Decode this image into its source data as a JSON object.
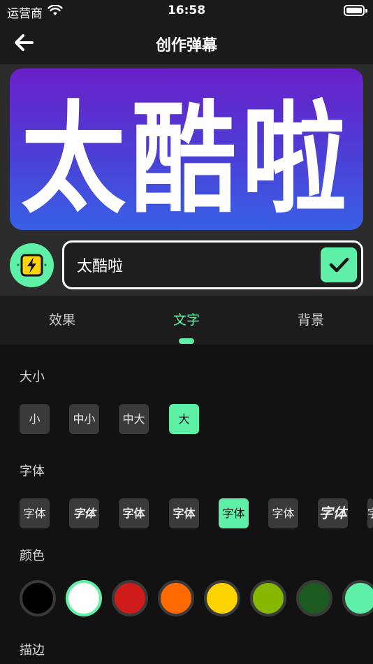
{
  "status": {
    "carrier": "运营商",
    "time": "16:58"
  },
  "nav": {
    "title": "创作弹幕"
  },
  "preview": {
    "text": "太酷啦"
  },
  "editor": {
    "value": "太酷啦",
    "placeholder": ""
  },
  "tabs": [
    {
      "label": "效果",
      "active": false
    },
    {
      "label": "文字",
      "active": true
    },
    {
      "label": "背景",
      "active": false
    }
  ],
  "size": {
    "label": "大小",
    "options": [
      {
        "label": "小",
        "active": false
      },
      {
        "label": "中小",
        "active": false
      },
      {
        "label": "中大",
        "active": false
      },
      {
        "label": "大",
        "active": true
      }
    ]
  },
  "font": {
    "label": "字体",
    "options": [
      {
        "label": "字体",
        "style": "regular",
        "active": false
      },
      {
        "label": "字体",
        "style": "italic",
        "active": false
      },
      {
        "label": "字体",
        "style": "bold",
        "active": false
      },
      {
        "label": "字体",
        "style": "bold",
        "active": false
      },
      {
        "label": "字体",
        "style": "regular",
        "active": true
      },
      {
        "label": "字体",
        "style": "regular",
        "active": false
      },
      {
        "label": "字体",
        "style": "italic",
        "active": false
      },
      {
        "label": "字体",
        "style": "regular",
        "active": false
      }
    ]
  },
  "color": {
    "label": "颜色",
    "swatches": [
      "#000000",
      "#ffffff",
      "#d01b1b",
      "#ff6a00",
      "#ffd300",
      "#86b800",
      "#1d5a1f",
      "#5ef0a6"
    ],
    "selected_index": 1
  },
  "stroke": {
    "label": "描边"
  },
  "theme": {
    "accent": "#5ef0a6",
    "background": "#121212",
    "gradient_top": "#6a1fc9",
    "gradient_bottom": "#3860e6"
  },
  "icons": {
    "back": "arrow-left-icon",
    "bolt": "lightning-icon",
    "confirm": "checkmark-icon",
    "wifi": "wifi-icon",
    "battery": "battery-icon"
  }
}
